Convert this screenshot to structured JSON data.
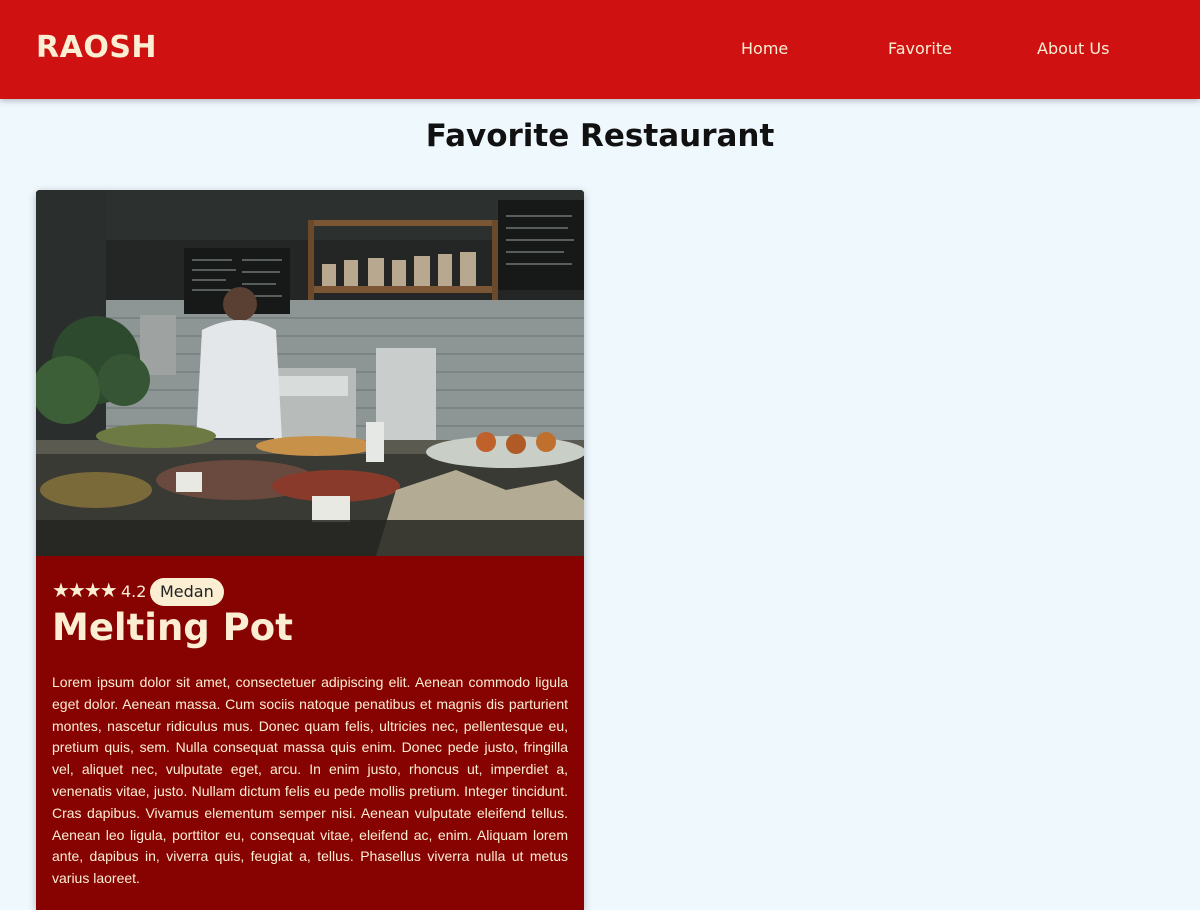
{
  "nav": {
    "brand": "RAOSH",
    "links": [
      "Home",
      "Favorite",
      "About Us"
    ]
  },
  "page": {
    "title": "Favorite Restaurant"
  },
  "restaurant": {
    "rating": "4.2",
    "stars_icon": "star-icon",
    "stars_count": 4,
    "city": "Medan",
    "name": "Melting Pot",
    "description": "Lorem ipsum dolor sit amet, consectetuer adipiscing elit. Aenean commodo ligula eget dolor. Aenean massa. Cum sociis natoque penatibus et magnis dis parturient montes, nascetur ridiculus mus. Donec quam felis, ultricies nec, pellentesque eu, pretium quis, sem. Nulla consequat massa quis enim. Donec pede justo, fringilla vel, aliquet nec, vulputate eget, arcu. In enim justo, rhoncus ut, imperdiet a, venenatis vitae, justo. Nullam dictum felis eu pede mollis pretium. Integer tincidunt. Cras dapibus. Vivamus elementum semper nisi. Aenean vulputate eleifend tellus. Aenean leo ligula, porttitor eu, consequat vitae, eleifend ac, enim. Aliquam lorem ante, dapibus in, viverra quis, feugiat a, tellus. Phasellus viverra nulla ut metus varius laoreet."
  },
  "colors": {
    "navbar": "#cf1112",
    "card": "#860302",
    "accent_text": "#fbeed3",
    "background": "#eef8fd"
  }
}
